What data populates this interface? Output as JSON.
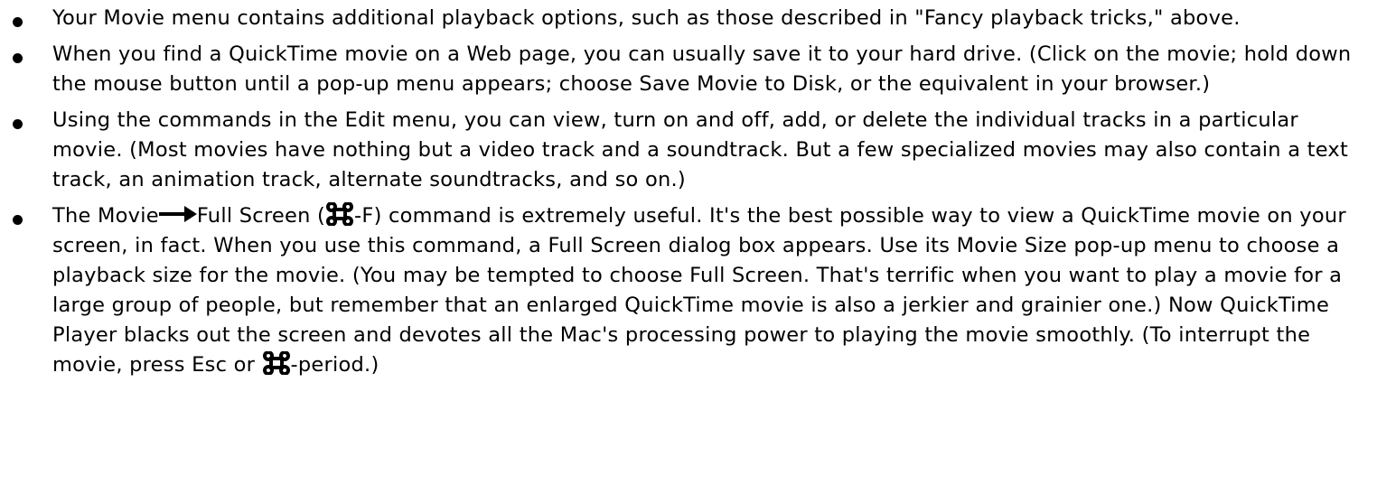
{
  "items": [
    {
      "text": "Your Movie menu contains additional playback options, such as those described in \"Fancy playback tricks,\" above."
    },
    {
      "text": "When you find a QuickTime movie on a Web page, you can usually save it to your hard drive. (Click on the movie; hold down the mouse button until a pop-up menu appears; choose Save Movie to Disk, or the equivalent in your browser.)"
    },
    {
      "text": "Using the commands in the Edit menu, you can view, turn on and off, add, or delete the individual tracks in a particular movie. (Most movies have nothing but a video track and a soundtrack. But a few specialized movies may also contain a text track, an animation track, alternate soundtracks, and so on.)"
    },
    {
      "part1": "The Movie",
      "part2": "Full Screen (",
      "part3": "-F) command is extremely useful. It's the best possible way to view a QuickTime movie on your screen, in fact. When you use this command, a Full Screen dialog box appears. Use its Movie Size pop-up menu to choose a playback size for the movie. (You may be tempted to choose Full Screen. That's terrific when you want to play a movie for a large group of people, but remember that an enlarged QuickTime movie is also a jerkier and grainier one.) Now QuickTime Player blacks out the screen and devotes all the Mac's processing power to playing the movie smoothly. (To interrupt the movie, press Esc or ",
      "part4": "-period.)"
    }
  ],
  "icons": {
    "bullet": "bullet-dot",
    "menu_arrow": "right-arrow-icon",
    "command_key": "command-key-icon"
  }
}
